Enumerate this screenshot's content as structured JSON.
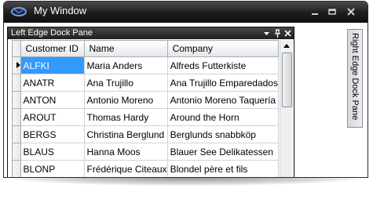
{
  "window": {
    "title": "My Window"
  },
  "left_pane": {
    "title": "Left Edge Dock Pane"
  },
  "right_pane": {
    "title": "Right Edge Dock Pane"
  },
  "grid": {
    "columns": [
      "Customer ID",
      "Name",
      "Company"
    ],
    "rows": [
      {
        "id": "ALFKI",
        "name": "Maria Anders",
        "company": "Alfreds Futterkiste",
        "selected": true
      },
      {
        "id": "ANATR",
        "name": "Ana Trujillo",
        "company": "Ana Trujillo Emparedados"
      },
      {
        "id": "ANTON",
        "name": "Antonio Moreno",
        "company": "Antonio Moreno Taquería"
      },
      {
        "id": "AROUT",
        "name": "Thomas Hardy",
        "company": "Around the Horn"
      },
      {
        "id": "BERGS",
        "name": "Christina Berglund",
        "company": "Berglunds snabbköp"
      },
      {
        "id": "BLAUS",
        "name": "Hanna Moos",
        "company": "Blauer See Delikatessen"
      },
      {
        "id": "BLONP",
        "name": "Frédérique Citeaux",
        "company": "Blondel père et fils"
      }
    ]
  },
  "colors": {
    "selection": "#3399ff",
    "title_bar": "#1c1c1c",
    "accent_icon": "#3a6fd6"
  }
}
